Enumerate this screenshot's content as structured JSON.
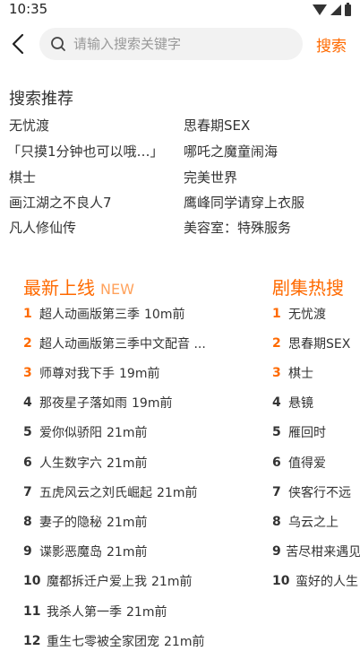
{
  "status_bar": {
    "time": "10:35"
  },
  "search": {
    "placeholder": "请输入搜索关键字",
    "submit_label": "搜索"
  },
  "recommend": {
    "title": "搜索推荐",
    "items": [
      "无忧渡",
      "思春期SEX",
      "「只摸1分钟也可以哦…」",
      "哪吒之魔童闹海",
      "棋士",
      "完美世界",
      "画江湖之不良人7",
      "鹰峰同学请穿上衣服",
      "凡人修仙传",
      "美容室：特殊服务"
    ]
  },
  "latest": {
    "title": "最新上线",
    "tag": "NEW",
    "items": [
      {
        "rank": "1",
        "title": "超人动画版第三季",
        "time": "10m前"
      },
      {
        "rank": "2",
        "title": "超人动画版第三季中文配音 ...",
        "time": ""
      },
      {
        "rank": "3",
        "title": "师尊对我下手",
        "time": "19m前"
      },
      {
        "rank": "4",
        "title": "那夜星子落如雨",
        "time": "19m前"
      },
      {
        "rank": "5",
        "title": "爱你似骄阳",
        "time": "21m前"
      },
      {
        "rank": "6",
        "title": "人生数字六",
        "time": "21m前"
      },
      {
        "rank": "7",
        "title": "五虎风云之刘氏崛起",
        "time": "21m前"
      },
      {
        "rank": "8",
        "title": "妻子的隐秘",
        "time": "21m前"
      },
      {
        "rank": "9",
        "title": "谍影恶魔岛",
        "time": "21m前"
      },
      {
        "rank": "10",
        "title": "魔都拆迁户爱上我",
        "time": "21m前"
      },
      {
        "rank": "11",
        "title": "我杀人第一季",
        "time": "21m前"
      },
      {
        "rank": "12",
        "title": "重生七零被全家团宠",
        "time": "21m前"
      }
    ]
  },
  "hot": {
    "title": "剧集热搜",
    "items": [
      {
        "rank": "1",
        "title": "无忧渡"
      },
      {
        "rank": "2",
        "title": "思春期SEX"
      },
      {
        "rank": "3",
        "title": "棋士"
      },
      {
        "rank": "4",
        "title": "悬镜"
      },
      {
        "rank": "5",
        "title": "雁回时"
      },
      {
        "rank": "6",
        "title": "值得爱"
      },
      {
        "rank": "7",
        "title": "侠客行不远"
      },
      {
        "rank": "8",
        "title": "乌云之上"
      },
      {
        "rank": "9",
        "title": "苦尽柑来遇见你"
      },
      {
        "rank": "10",
        "title": "蛮好的人生"
      }
    ]
  },
  "colors": {
    "accent": "#ff6a00",
    "accent_light": "#ffa25c",
    "search_bg": "#f2f2f2"
  },
  "icons": [
    "wifi-icon",
    "signal-icon",
    "battery-icon",
    "back-arrow-icon",
    "search-icon"
  ]
}
